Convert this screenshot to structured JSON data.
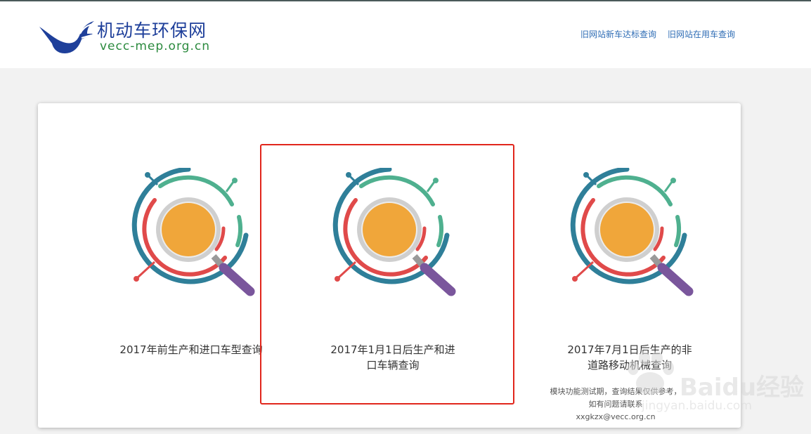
{
  "header": {
    "logo_cn": "机动车环保网",
    "logo_en": "vecc-mep.org.cn",
    "nav": [
      {
        "label": "旧网站新车达标查询"
      },
      {
        "label": "旧网站在用车查询"
      }
    ]
  },
  "cards": [
    {
      "label": "2017年前生产和进口车型查询"
    },
    {
      "label": "2017年1月1日后生产和进口车辆查询"
    },
    {
      "label": "2017年7月1日后生产的非道路移动机械查询"
    }
  ],
  "note": {
    "text": "模块功能测试期，查询结果仅供参考，如有问题请联系",
    "email": "xxgkzx@vecc.org.cn"
  },
  "watermark": {
    "text": "Baidu经验",
    "sub": "jingyan.baidu.com"
  },
  "colors": {
    "brand_blue": "#1e3f9a",
    "brand_green": "#2b8a3e",
    "nav_link": "#2f6db5",
    "highlight": "#e1261c",
    "ring_teal": "#2f7f99",
    "ring_green": "#4fb08f",
    "ring_red": "#e04a4a",
    "lens": "#f0a63a",
    "handle": "#7a569c"
  }
}
